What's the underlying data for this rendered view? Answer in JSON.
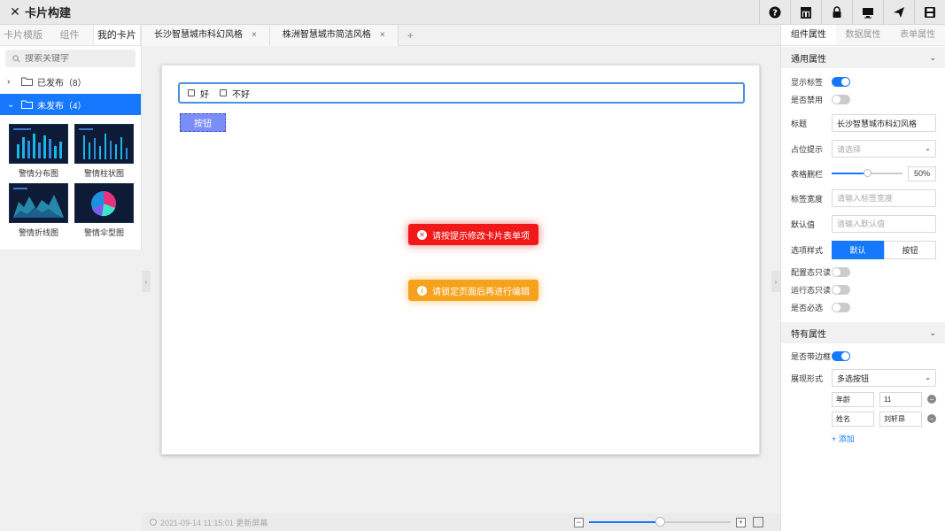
{
  "window": {
    "title": "卡片构建"
  },
  "toolbar": {
    "icons": [
      "help-icon",
      "layout-icon",
      "lock-icon",
      "monitor-icon",
      "send-icon",
      "save-icon"
    ]
  },
  "left_panel": {
    "tabs": [
      {
        "label": "卡片模版",
        "active": false
      },
      {
        "label": "组件",
        "active": false
      },
      {
        "label": "我的卡片",
        "active": true
      }
    ],
    "search_placeholder": "搜索关键字",
    "groups": [
      {
        "label": "已发布（8）",
        "expanded": false
      },
      {
        "label": "未发布（4）",
        "expanded": true
      }
    ],
    "cards": [
      {
        "label": "警情分布图",
        "kind": "bars"
      },
      {
        "label": "警情柱状图",
        "kind": "columns"
      },
      {
        "label": "警情折线图",
        "kind": "area"
      },
      {
        "label": "警情伞型图",
        "kind": "pie"
      }
    ]
  },
  "editor": {
    "tabs": [
      {
        "label": "长沙智慧城市科幻风格"
      },
      {
        "label": "株洲智慧城市简洁风格"
      }
    ],
    "add_tab": "+",
    "checkbox_options": [
      "好",
      "不好"
    ],
    "demo_button": "按钮",
    "toasts": {
      "error": "请按提示修改卡片表单项",
      "warning": "请锁定页面后再进行编辑"
    },
    "status": "2021-09-14 11:15:01 更新屏幕",
    "zoom_level": 0.5
  },
  "right_panel": {
    "tabs": [
      {
        "label": "组件属性",
        "active": true
      },
      {
        "label": "数据属性",
        "active": false
      },
      {
        "label": "表单属性",
        "active": false
      }
    ],
    "common_section": "通用属性",
    "show_label": {
      "label": "显示标签",
      "on": true
    },
    "disabled": {
      "label": "是否禁用",
      "on": false
    },
    "title": {
      "label": "标题",
      "value": "长沙智慧城市科幻风格"
    },
    "placeholder": {
      "label": "占位提示",
      "value": "请选择"
    },
    "grid": {
      "label": "表格删栏",
      "value": "50%",
      "fraction": 0.5
    },
    "label_width": {
      "label": "标签宽度",
      "placeholder": "请输入标签宽度"
    },
    "default_value": {
      "label": "默认值",
      "placeholder": "请输入默认值"
    },
    "option_style": {
      "label": "选项样式",
      "options": [
        "默认",
        "按钮"
      ],
      "selected": "默认"
    },
    "config_readonly": {
      "label": "配置态只读",
      "on": false
    },
    "runtime_readonly": {
      "label": "运行态只读",
      "on": false
    },
    "required": {
      "label": "是否必选",
      "on": false
    },
    "special_section": "特有属性",
    "bordered": {
      "label": "是否带边框",
      "on": true
    },
    "display_mode": {
      "label": "展现形式",
      "value": "多选按钮"
    },
    "kv_rows": [
      {
        "key": "年龄",
        "value": "11"
      },
      {
        "key": "姓名",
        "value": "刘轩昂"
      }
    ],
    "add_label": "+ 添加"
  }
}
